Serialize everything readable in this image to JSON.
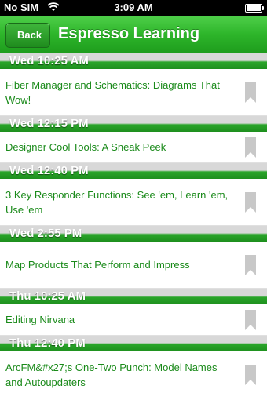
{
  "status_bar": {
    "carrier": "No SIM",
    "time": "3:09 AM"
  },
  "nav": {
    "back_label": "Back",
    "title": "Espresso Learning"
  },
  "sections": [
    {
      "header": "Wed 10:25 AM",
      "items": [
        {
          "title": "Fiber Manager and Schematics: Diagrams That Wow!"
        }
      ]
    },
    {
      "header": "Wed 12:15 PM",
      "items": [
        {
          "title": "Designer Cool Tools: A Sneak Peek"
        }
      ]
    },
    {
      "header": "Wed 12:40 PM",
      "items": [
        {
          "title": "3 Key Responder Functions: See 'em, Learn 'em, Use 'em"
        }
      ]
    },
    {
      "header": "Wed 2:55 PM",
      "items": [
        {
          "title": "Map Products That Perform and Impress"
        }
      ]
    },
    {
      "header": "Thu 10:25 AM",
      "items": [
        {
          "title": "Editing Nirvana"
        }
      ]
    },
    {
      "header": "Thu 12:40 PM",
      "items": [
        {
          "title": "ArcFM&#x27;s One-Two Punch: Model Names and Autoupdaters"
        }
      ]
    }
  ],
  "colors": {
    "accent_green": "#2db52a",
    "item_text": "#1a8a1a",
    "bookmark_gray": "#c8c8c8"
  },
  "icons": {
    "bookmark": "bookmark-icon",
    "wifi": "wifi-icon",
    "battery": "battery-icon"
  }
}
